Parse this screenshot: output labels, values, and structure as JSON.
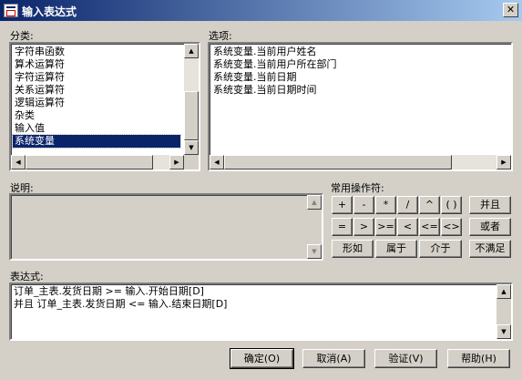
{
  "window": {
    "title": "输入表达式",
    "close_glyph": "✕"
  },
  "category": {
    "label": "分类:",
    "items": [
      "字符串函数",
      "算术运算符",
      "字符运算符",
      "关系运算符",
      "逻辑运算符",
      "杂类",
      "输入值",
      "系统变量"
    ],
    "selected_index": 7
  },
  "options": {
    "label": "选项:",
    "items": [
      "系统变量.当前用户姓名",
      "系统变量.当前用户所在部门",
      "系统变量.当前日期",
      "系统变量.当前日期时间"
    ]
  },
  "description": {
    "label": "说明:"
  },
  "operators": {
    "label": "常用操作符:",
    "row1": [
      "+",
      "-",
      "*",
      "/",
      "^",
      "( )"
    ],
    "row2": [
      "=",
      ">",
      ">=",
      "<",
      "<=",
      "<>"
    ],
    "row3": [
      "形如",
      "属于",
      "介于"
    ],
    "logic": [
      "并且",
      "或者",
      "不满足"
    ]
  },
  "expression": {
    "label": "表达式:",
    "lines": [
      "订单_主表.发货日期 >= 输入.开始日期[D]",
      "并且 订单_主表.发货日期 <= 输入.结束日期[D]"
    ]
  },
  "buttons": {
    "ok": "确定(O)",
    "cancel": "取消(A)",
    "verify": "验证(V)",
    "help": "帮助(H)"
  },
  "scroll_arrows": {
    "up": "▲",
    "down": "▼",
    "left": "◀",
    "right": "▶"
  }
}
